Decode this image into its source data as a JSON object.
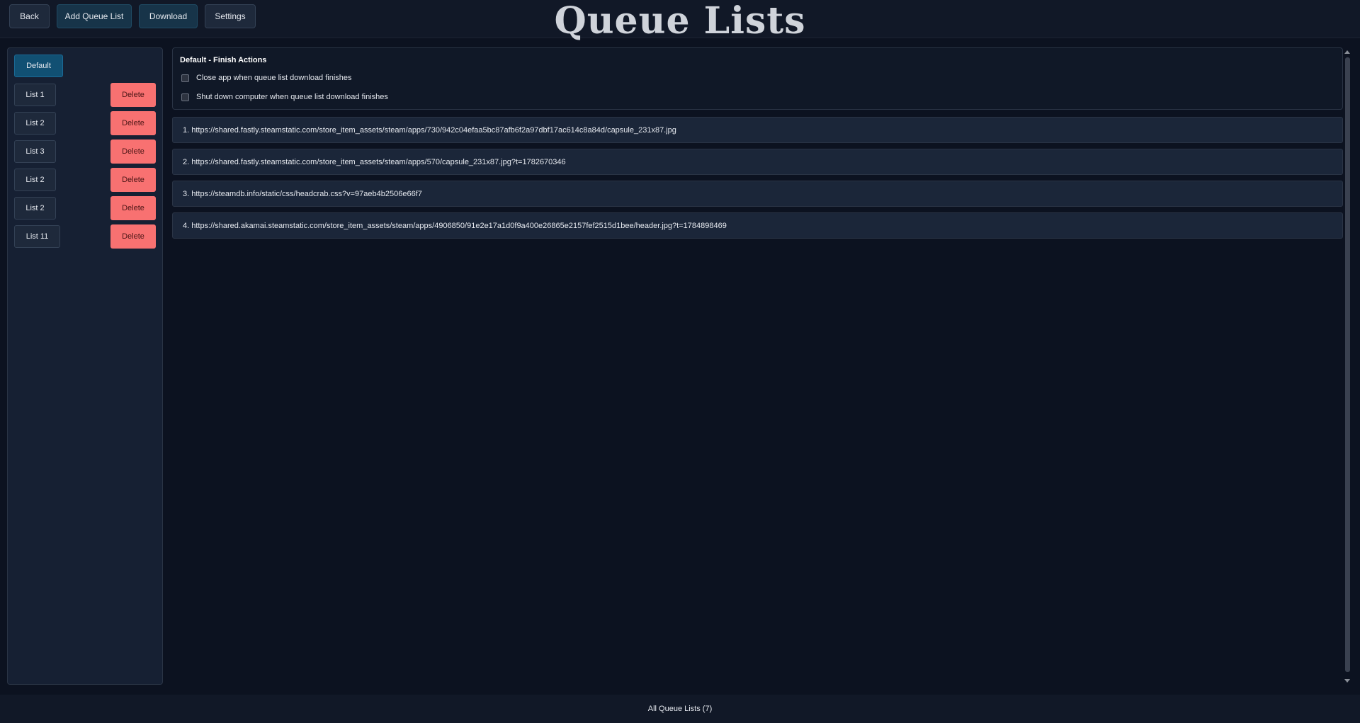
{
  "toolbar": {
    "back_label": "Back",
    "add_queue_list_label": "Add Queue List",
    "download_label": "Download",
    "settings_label": "Settings"
  },
  "page_title": "Queue Lists",
  "sidebar": {
    "items": [
      {
        "label": "Default",
        "active": true
      },
      {
        "label": "List 1",
        "delete_label": "Delete"
      },
      {
        "label": "List 2",
        "delete_label": "Delete"
      },
      {
        "label": "List 3",
        "delete_label": "Delete"
      },
      {
        "label": "List 2",
        "delete_label": "Delete"
      },
      {
        "label": "List 2",
        "delete_label": "Delete"
      },
      {
        "label": "List 11",
        "delete_label": "Delete"
      }
    ]
  },
  "finish_actions": {
    "title": "Default - Finish Actions",
    "close_app_label": "Close app when queue list download finishes",
    "shutdown_label": "Shut down computer when queue list download finishes"
  },
  "queue_items": [
    "1. https://shared.fastly.steamstatic.com/store_item_assets/steam/apps/730/942c04efaa5bc87afb6f2a97dbf17ac614c8a84d/capsule_231x87.jpg",
    "2. https://shared.fastly.steamstatic.com/store_item_assets/steam/apps/570/capsule_231x87.jpg?t=1782670346",
    "3. https://steamdb.info/static/css/headcrab.css?v=97aeb4b2506e66f7",
    "4. https://shared.akamai.steamstatic.com/store_item_assets/steam/apps/4906850/91e2e17a1d0f9a400e26865e2157fef2515d1bee/header.jpg?t=1784898469"
  ],
  "footer": {
    "label": "All Queue Lists (7)"
  },
  "colors": {
    "background": "#0c1220",
    "active_list": "#115073",
    "delete": "#f87171"
  }
}
